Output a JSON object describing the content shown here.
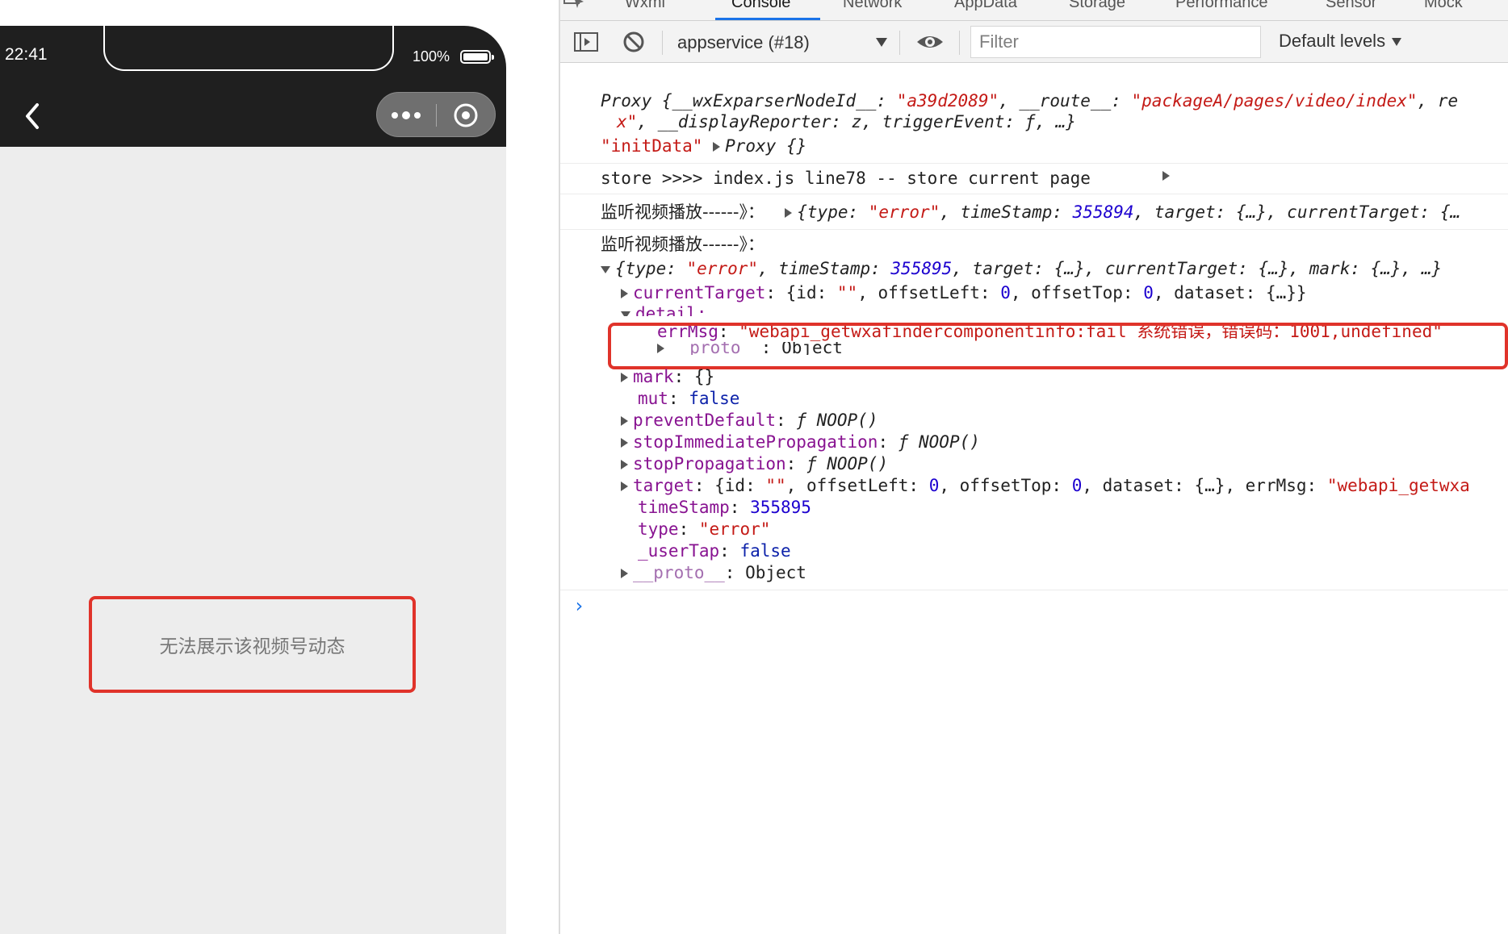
{
  "phone": {
    "status_time": "22:41",
    "battery_text": "100%",
    "battery_level": 1.0,
    "fallback_text": "无法展示该视频号动态"
  },
  "devtools": {
    "tabs": [
      "Wxml",
      "Console",
      "Network",
      "AppData",
      "Storage",
      "Performance",
      "Sensor",
      "Mock"
    ],
    "active_tab": "Console",
    "context_label": "appservice (#18)",
    "filter_placeholder": "Filter",
    "levels_label": "Default levels",
    "accent_color": "#1a73e8",
    "highlight_color": "#e0332a"
  },
  "console": {
    "msg1_line1_prefix": "Proxy {",
    "msg1_key1": "__wxExparserNodeId__",
    "msg1_val1": "\"a39d2089\"",
    "msg1_key2": "__route__",
    "msg1_val2": "\"packageA/pages/video/index\"",
    "msg1_tail1": ", re",
    "msg1_line2_str": "x\"",
    "msg1_line2_rest": ", __displayReporter: z, triggerEvent: ƒ, …}",
    "msg1_initdata_key": "\"initData\"",
    "msg1_initdata_val": "Proxy {}",
    "msg2_text": "store >>>> index.js line78 -- store current page",
    "msg3_label": "监听视频播放------》：",
    "msg3_obj_prefix": "{type: ",
    "msg3_type": "\"error\"",
    "msg3_ts_key": ", timeStamp: ",
    "msg3_ts": "355894",
    "msg3_rest": ", target: {…}, currentTarget: {…",
    "msg4_label": "监听视频播放------》：",
    "msg4_obj_prefix": "{type: ",
    "msg4_type": "\"error\"",
    "msg4_ts_key": ", timeStamp: ",
    "msg4_ts": "355895",
    "msg4_rest": ", target: {…}, currentTarget: {…}, mark: {…}, …}",
    "ct_key": "currentTarget",
    "ct_val_a": ": {id: ",
    "ct_id": "\"\"",
    "ct_val_b": ", offsetLeft: ",
    "ct_ol": "0",
    "ct_val_c": ", offsetTop: ",
    "ct_ot": "0",
    "ct_val_d": ", dataset: {…}}",
    "detail_key": "detail:",
    "errmsg_key": "errMsg",
    "errmsg_val": "\"webapi_getwxafindercomponentinfo:fail 系统错误，错误码：1001,undefined\"",
    "proto1_key": "__proto__",
    "proto1_val": ": Object",
    "mark_key": "mark",
    "mark_val": ": {}",
    "mut_key": "mut",
    "mut_val": "false",
    "pd_key": "preventDefault",
    "pd_val": "ƒ NOOP()",
    "sip_key": "stopImmediatePropagation",
    "sip_val": "ƒ NOOP()",
    "sp_key": "stopPropagation",
    "sp_val": "ƒ NOOP()",
    "target_key": "target",
    "target_val_a": ": {id: ",
    "target_id": "\"\"",
    "target_val_b": ", offsetLeft: ",
    "target_ol": "0",
    "target_val_c": ", offsetTop: ",
    "target_ot": "0",
    "target_val_d": ", dataset: {…}, errMsg: ",
    "target_err": "\"webapi_getwxa",
    "timestamp_key": "timeStamp",
    "timestamp_val": "355895",
    "type_key": "type",
    "type_val": "\"error\"",
    "usertap_key": "_userTap",
    "usertap_val": "false",
    "proto2_key": "__proto__",
    "proto2_val": ": Object",
    "prompt_symbol": "›"
  }
}
